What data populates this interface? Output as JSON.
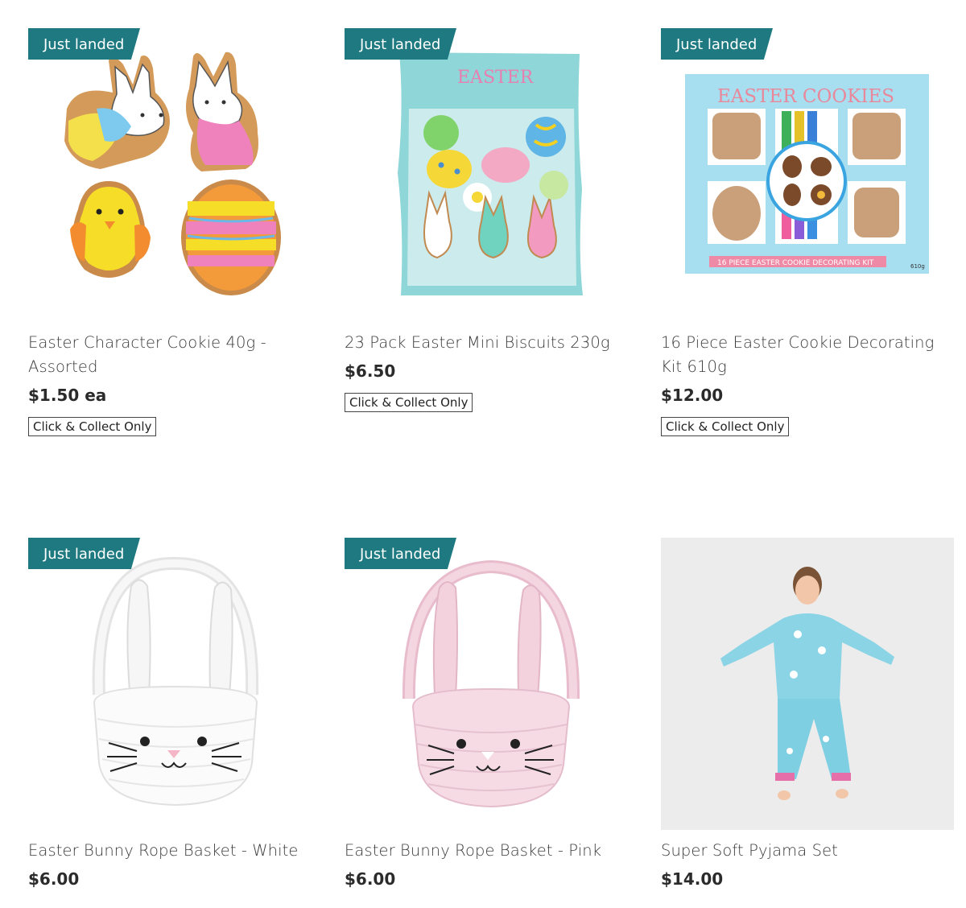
{
  "colors": {
    "badge": "#1e7a80",
    "text": "#3a3a3a",
    "price": "#2b2b2b"
  },
  "products": [
    {
      "badge": "Just landed",
      "name": "Easter Character Cookie 40g - Assorted",
      "price": "$1.50 ea",
      "collect": "Click & Collect Only",
      "image": "easter-character-cookies-image"
    },
    {
      "badge": "Just landed",
      "name": "23 Pack Easter Mini Biscuits 230g",
      "price": "$6.50",
      "collect": "Click & Collect Only",
      "image": "mini-biscuits-bag-image"
    },
    {
      "badge": "Just landed",
      "name": "16 Piece Easter Cookie Decorating Kit 610g",
      "price": "$12.00",
      "collect": "Click & Collect Only",
      "image": "cookie-kit-box-image",
      "box_title": "EASTER COOKIES",
      "box_sub": "16 PIECE EASTER COOKIE DECORATING KIT",
      "box_weight": "610g",
      "bag_title": "EASTER"
    },
    {
      "badge": "Just landed",
      "name": "Easter Bunny Rope Basket - White",
      "price": "$6.00",
      "image": "white-bunny-basket-image"
    },
    {
      "badge": "Just landed",
      "name": "Easter Bunny Rope Basket - Pink",
      "price": "$6.00",
      "image": "pink-bunny-basket-image"
    },
    {
      "name": "Super Soft Pyjama Set",
      "price": "$14.00",
      "image": "child-pyjama-photo"
    }
  ]
}
